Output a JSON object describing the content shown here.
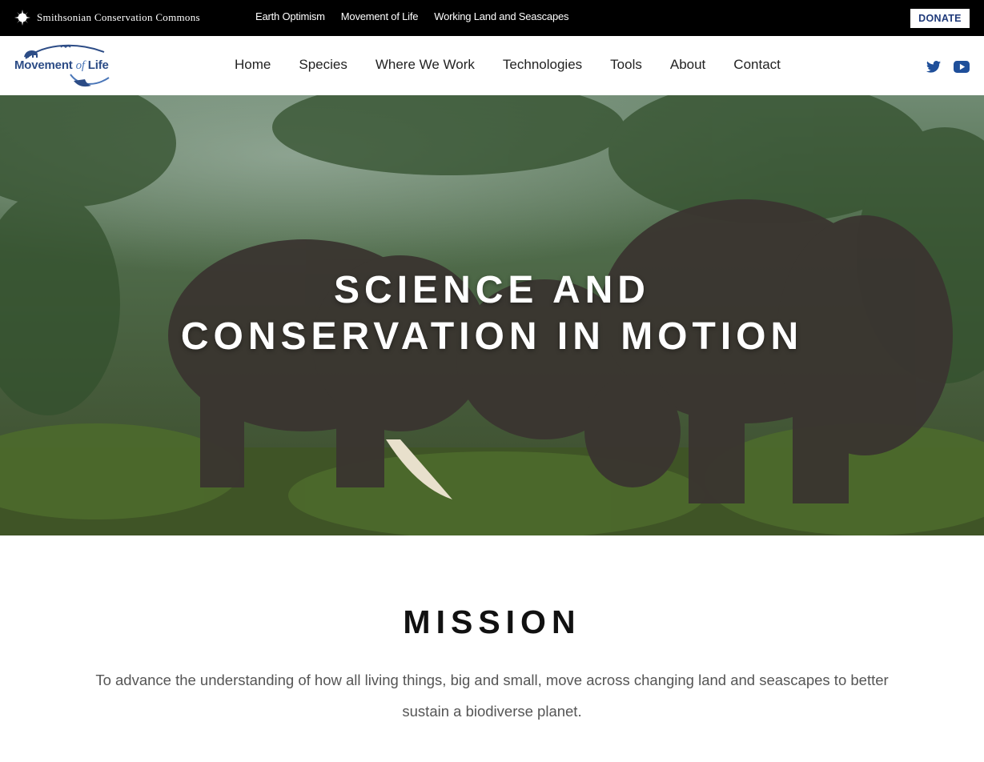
{
  "topbar": {
    "brand": "Smithsonian Conservation Commons",
    "links": [
      "Earth Optimism",
      "Movement of Life",
      "Working Land and Seascapes"
    ],
    "donate": "DONATE"
  },
  "header": {
    "logo": {
      "part1": "Movement ",
      "part2": "of",
      "part3": " Life"
    },
    "nav": [
      "Home",
      "Species",
      "Where We Work",
      "Technologies",
      "Tools",
      "About",
      "Contact"
    ],
    "social_icons": [
      "twitter-icon",
      "youtube-icon"
    ]
  },
  "hero": {
    "line1": "SCIENCE AND",
    "line2": "CONSERVATION IN MOTION"
  },
  "mission": {
    "title": "MISSION",
    "text": "To advance the understanding of how all living things, big and small, move across changing land and seascapes to better sustain a biodiverse planet."
  },
  "colors": {
    "topbar_bg": "#000000",
    "brand_blue": "#2c4c86",
    "donate_text": "#1f3a7a",
    "twitter_blue": "#1f4f9a",
    "youtube_blue": "#1f4f9a"
  }
}
